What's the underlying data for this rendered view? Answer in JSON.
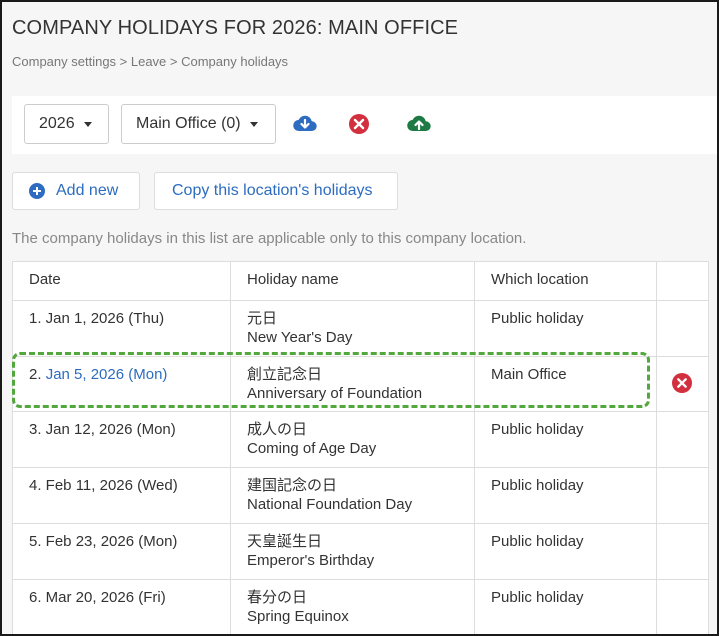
{
  "header": {
    "title": "COMPANY HOLIDAYS FOR 2026: MAIN OFFICE",
    "breadcrumb": "Company settings > Leave > Company holidays"
  },
  "toolbar": {
    "year_value": "2026",
    "location_value": "Main Office (0)",
    "icons": [
      "cloud-download-icon",
      "delete-icon",
      "cloud-upload-icon"
    ]
  },
  "actions": {
    "add_new_label": "Add new",
    "copy_label": "Copy this location's holidays"
  },
  "note": "The company holidays in this list are applicable only to this company location.",
  "table": {
    "headers": [
      "Date",
      "Holiday name",
      "Which location"
    ],
    "rows": [
      {
        "date": "1. Jan 1, 2026 (Thu)",
        "name_jp": "元日",
        "name_en": "New Year's Day",
        "location": "Public holiday"
      },
      {
        "date_prefix": "2.",
        "date": "Jan 5, 2026 (Mon)",
        "name_jp": "創立記念日",
        "name_en": "Anniversary of Foundation",
        "location": "Main Office"
      },
      {
        "date": "3. Jan 12, 2026 (Mon)",
        "name_jp": "成人の日",
        "name_en": "Coming of Age Day",
        "location": "Public holiday"
      },
      {
        "date": "4. Feb 11, 2026 (Wed)",
        "name_jp": "建国記念の日",
        "name_en": "National Foundation Day",
        "location": "Public holiday"
      },
      {
        "date": "5. Feb 23, 2026 (Mon)",
        "name_jp": "天皇誕生日",
        "name_en": "Emperor's Birthday",
        "location": "Public holiday"
      },
      {
        "date": "6. Mar 20, 2026 (Fri)",
        "name_jp": "春分の日",
        "name_en": "Spring Equinox",
        "location": "Public holiday"
      }
    ]
  },
  "colors": {
    "link": "#2d6cc0",
    "delete": "#d3303f",
    "upload": "#1e7a45",
    "highlight": "#52a83c"
  }
}
